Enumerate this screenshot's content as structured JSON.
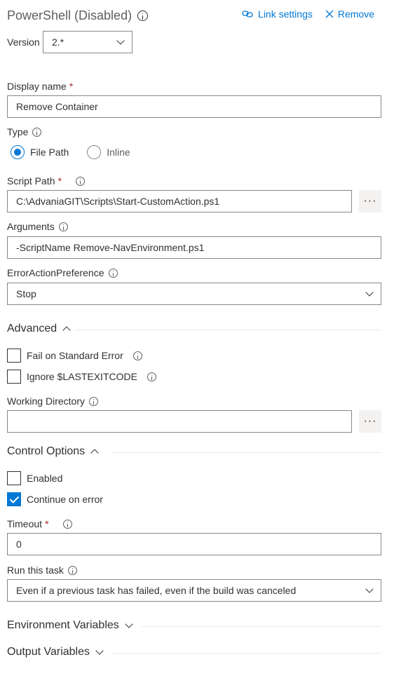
{
  "header": {
    "title": "PowerShell (Disabled)",
    "link_settings": "Link settings",
    "remove": "Remove"
  },
  "version": {
    "label": "Version",
    "value": "2.*"
  },
  "display_name": {
    "label": "Display name",
    "required": "*",
    "value": "Remove Container"
  },
  "type": {
    "label": "Type",
    "options": [
      {
        "label": "File Path",
        "selected": true
      },
      {
        "label": "Inline",
        "selected": false
      }
    ]
  },
  "script_path": {
    "label": "Script Path",
    "required": "*",
    "value": "C:\\AdvaniaGIT\\Scripts\\Start-CustomAction.ps1",
    "button": "···"
  },
  "arguments": {
    "label": "Arguments",
    "value": "-ScriptName Remove-NavEnvironment.ps1"
  },
  "error_action": {
    "label": "ErrorActionPreference",
    "value": "Stop"
  },
  "advanced": {
    "title": "Advanced",
    "fail_on_stderr": {
      "label": "Fail on Standard Error",
      "checked": false
    },
    "ignore_lastexitcode": {
      "label": "Ignore $LASTEXITCODE",
      "checked": false
    },
    "working_directory": {
      "label": "Working Directory",
      "value": "",
      "button": "···"
    }
  },
  "control_options": {
    "title": "Control Options",
    "enabled": {
      "label": "Enabled",
      "checked": false
    },
    "continue_on_error": {
      "label": "Continue on error",
      "checked": true
    },
    "timeout": {
      "label": "Timeout",
      "required": "*",
      "value": "0"
    },
    "run_this_task": {
      "label": "Run this task",
      "value": "Even if a previous task has failed, even if the build was canceled"
    }
  },
  "environment_variables": {
    "title": "Environment Variables"
  },
  "output_variables": {
    "title": "Output Variables"
  },
  "colors": {
    "accent": "#0078d4",
    "required": "#a4262c",
    "text": "#323130"
  }
}
